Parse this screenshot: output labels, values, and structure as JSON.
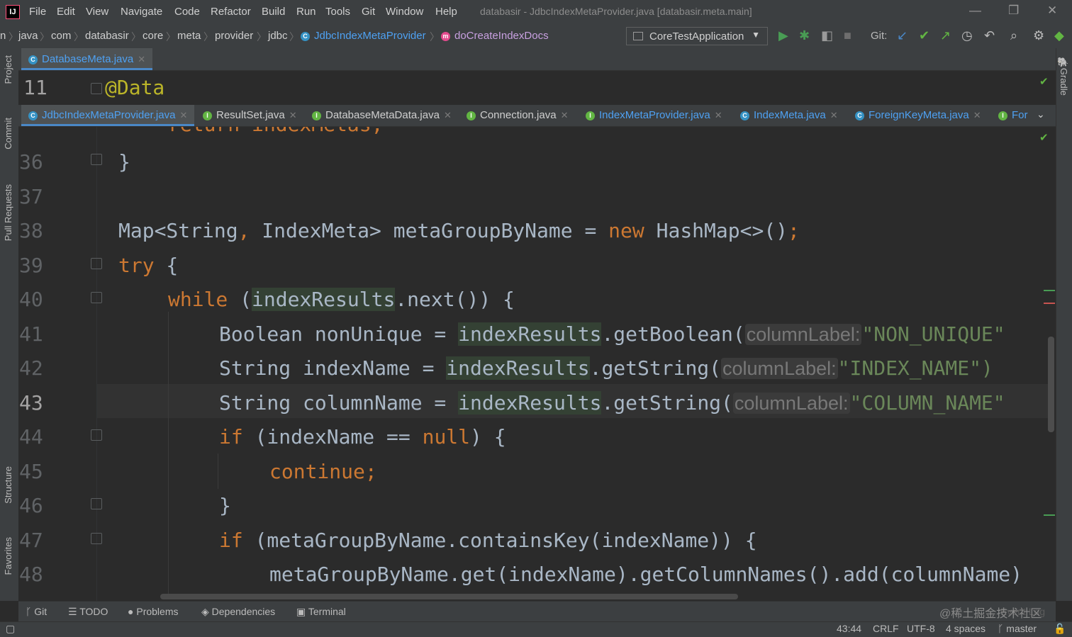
{
  "menubar": {
    "items": [
      "File",
      "Edit",
      "View",
      "Navigate",
      "Code",
      "Refactor",
      "Build",
      "Run",
      "Tools",
      "Git",
      "Window",
      "Help"
    ],
    "window_title": "databasir - JdbcIndexMetaProvider.java [databasir.meta.main]",
    "app_icon_text": "IJ"
  },
  "navbar": {
    "breadcrumbs": [
      "n",
      "java",
      "com",
      "databasir",
      "core",
      "meta",
      "provider",
      "jdbc",
      "JdbcIndexMetaProvider",
      "doCreateIndexDocs"
    ],
    "run_config": "CoreTestApplication",
    "git_label": "Git:"
  },
  "tabs_top": [
    {
      "name": "DatabaseMeta.java",
      "badge": "C"
    }
  ],
  "tabs_split": [
    {
      "name": "JdbcIndexMetaProvider.java",
      "badge": "C"
    },
    {
      "name": "ResultSet.java",
      "badge": "I"
    },
    {
      "name": "DatabaseMetaData.java",
      "badge": "I"
    },
    {
      "name": "Connection.java",
      "badge": "I"
    },
    {
      "name": "IndexMetaProvider.java",
      "badge": "I"
    },
    {
      "name": "IndexMeta.java",
      "badge": "C"
    },
    {
      "name": "ForeignKeyMeta.java",
      "badge": "C"
    },
    {
      "name": "For",
      "badge": "I"
    }
  ],
  "editor_top": {
    "line_number": "11",
    "code": "@Data"
  },
  "editor_main": {
    "partial_top": "return indexMetas;",
    "lines": [
      {
        "num": "36",
        "text": "}"
      },
      {
        "num": "37",
        "text": ""
      },
      {
        "num": "38",
        "t1": "Map<String",
        "t2": ", ",
        "t3": "IndexMeta> metaGroupByName = ",
        "kw": "new",
        "t4": " HashMap<>()",
        "t5": ";"
      },
      {
        "num": "39",
        "kw": "try",
        "t1": " {"
      },
      {
        "num": "40",
        "kw": "while",
        "t1": " (",
        "hl": "indexResults",
        "t2": ".next()) {"
      },
      {
        "num": "41",
        "t1": "Boolean nonUnique = ",
        "hl": "indexResults",
        "t2": ".getBoolean(",
        "hint": "columnLabel:",
        "str": "\"NON_UNIQUE\""
      },
      {
        "num": "42",
        "t1": "String indexName = ",
        "hl": "indexResults",
        "t2": ".getString(",
        "hint": "columnLabel:",
        "str": "\"INDEX_NAME\")"
      },
      {
        "num": "43",
        "t1": "String columnName = ",
        "hl": "indexResults",
        "t2": ".getString(",
        "hint": "columnLabel:",
        "str": "\"COLUMN_NAME\""
      },
      {
        "num": "44",
        "kw": "if",
        "t1": " (indexName == ",
        "kw2": "null",
        "t2": ") {"
      },
      {
        "num": "45",
        "kw": "continue",
        "t1": ";"
      },
      {
        "num": "46",
        "text": "}"
      },
      {
        "num": "47",
        "kw": "if",
        "t1": " (metaGroupByName.containsKey(indexName)) {"
      },
      {
        "num": "48",
        "text": "metaGroupByName.get(indexName).getColumnNames().add(columnName)"
      }
    ]
  },
  "left_tools": [
    "Project",
    "Commit",
    "Pull Requests",
    "Structure",
    "Favorites"
  ],
  "right_tools": [
    "Gradle"
  ],
  "bottom_tools": [
    "Git",
    "TODO",
    "Problems",
    "Dependencies",
    "Terminal",
    "Event Log"
  ],
  "status": {
    "position": "43:44",
    "line_sep": "CRLF",
    "encoding": "UTF-8",
    "indent": "4 spaces",
    "branch": "master"
  },
  "watermark": "@稀土掘金技术社区",
  "colors": {
    "keyword": "#cc7832",
    "string": "#6a8759",
    "annotation": "#bbb529",
    "class_link": "#4ea1f2",
    "accent": "#4a88c7"
  }
}
